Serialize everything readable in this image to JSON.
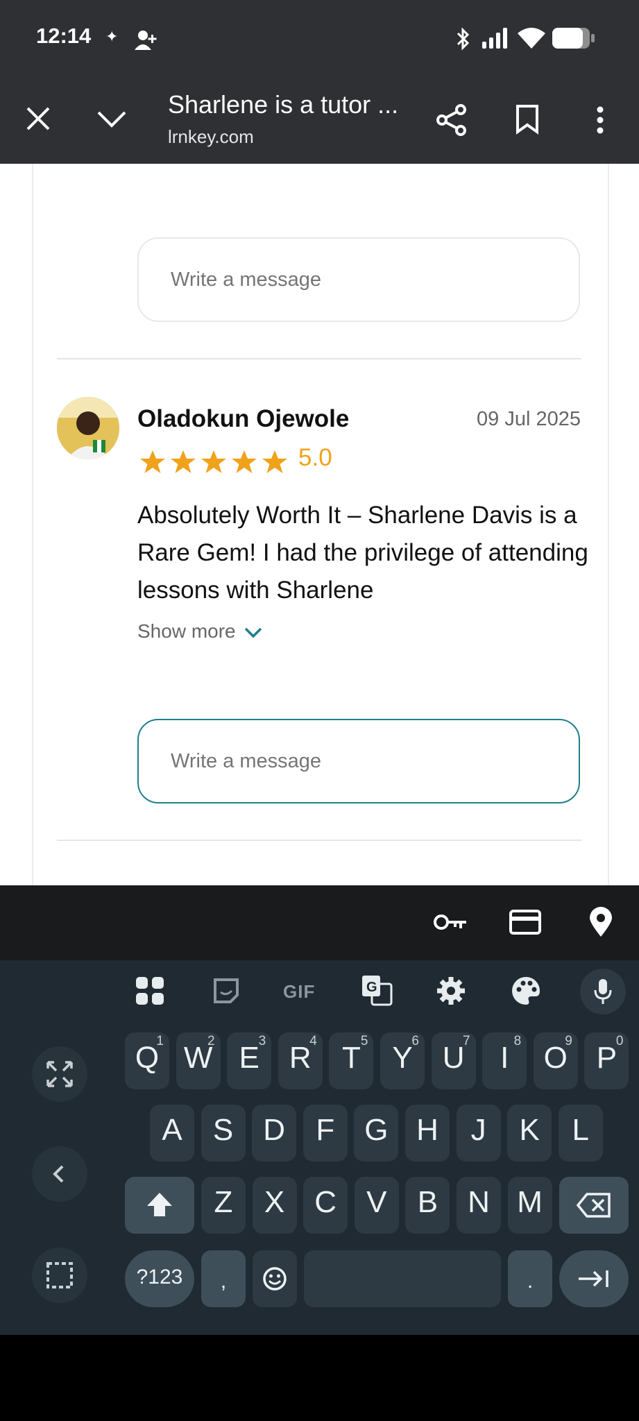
{
  "status_bar": {
    "time": "12:14"
  },
  "browser": {
    "tab_title": "Sharlene is a tutor ...",
    "url": "lrnkey.com"
  },
  "page": {
    "message_box_1": {
      "placeholder": "Write a message"
    },
    "review": {
      "reviewer_name": "Oladokun Ojewole",
      "date": "09 Jul 2025",
      "rating": "5.0",
      "stars": 5,
      "text": "Absolutely Worth It – Sharlene Davis is a Rare Gem! I had the privilege of attending lessons with Sharlene",
      "show_more_label": "Show more"
    },
    "message_box_2": {
      "placeholder": "Write a message"
    }
  },
  "keyboard": {
    "row1": [
      "Q",
      "W",
      "E",
      "R",
      "T",
      "Y",
      "U",
      "I",
      "O",
      "P"
    ],
    "row1_hints": [
      "1",
      "2",
      "3",
      "4",
      "5",
      "6",
      "7",
      "8",
      "9",
      "0"
    ],
    "row2": [
      "A",
      "S",
      "D",
      "F",
      "G",
      "H",
      "J",
      "K",
      "L"
    ],
    "row3": [
      "Z",
      "X",
      "C",
      "V",
      "B",
      "N",
      "M"
    ],
    "symbols_label": "?123",
    "comma_label": ",",
    "period_label": ".",
    "gif_label": "GIF"
  },
  "colors": {
    "accent_star": "#f0a21a",
    "focus_border": "#1e7f8c",
    "keyboard_bg": "#1f2a32"
  }
}
